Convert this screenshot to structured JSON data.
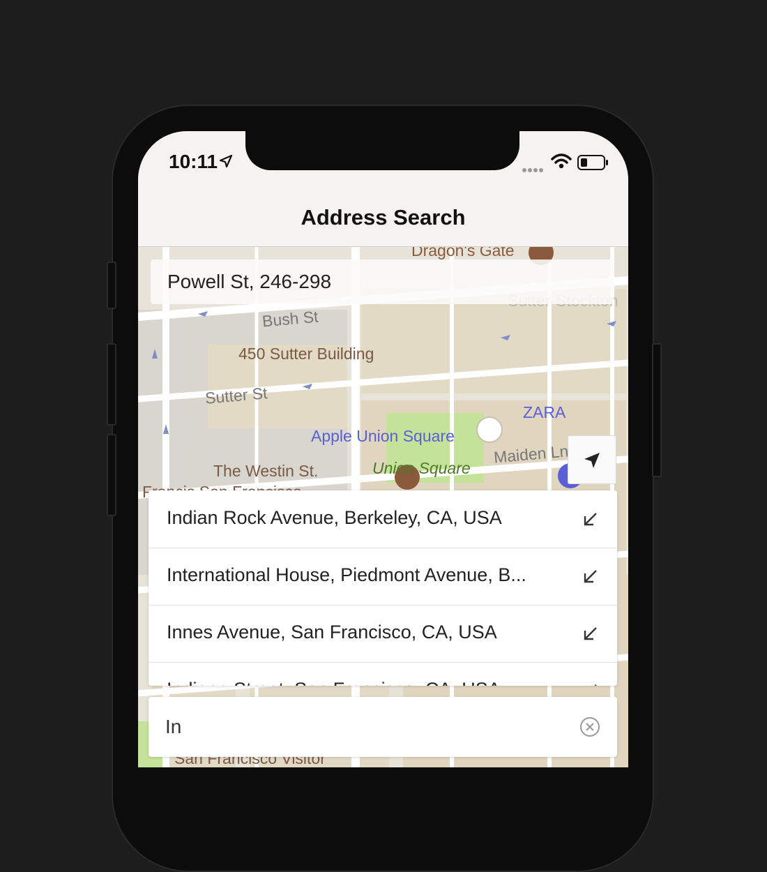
{
  "status_bar": {
    "time": "10:11"
  },
  "nav": {
    "title": "Address Search"
  },
  "address_bar": {
    "text": "Powell St, 246-298"
  },
  "map": {
    "labels": {
      "dragons_gate": "Dragon's Gate",
      "bush_st": "Bush St",
      "sutter_stockton": "Sutter-Stockton",
      "sutter_building": "450 Sutter Building",
      "sutter_st": "Sutter St",
      "zara": "ZARA",
      "apple_union_square": "Apple Union Square",
      "union_square": "Union Square",
      "maiden_ln": "Maiden Ln",
      "westin": "The Westin St.",
      "francis": "Francis San Francisco...",
      "visitor": "San Francisco Visitor"
    },
    "colors": {
      "base": "#e8e3d8",
      "street": "#ffffff",
      "park": "#c5e29a",
      "pin": "#2f9be8",
      "shop": "#5a5fd6",
      "poi": "#8b5a3c"
    }
  },
  "results": [
    {
      "label": "Indian Rock Avenue, Berkeley, CA, USA",
      "icon": "arrow-down-left-icon"
    },
    {
      "label": "International House, Piedmont Avenue, B...",
      "icon": "arrow-down-left-icon"
    },
    {
      "label": "Innes Avenue, San Francisco, CA, USA",
      "icon": "arrow-down-left-icon"
    },
    {
      "label": "Indiana Street, San Francisco, CA, USA",
      "icon": "arrow-down-left-icon"
    }
  ],
  "search": {
    "value": "In"
  }
}
